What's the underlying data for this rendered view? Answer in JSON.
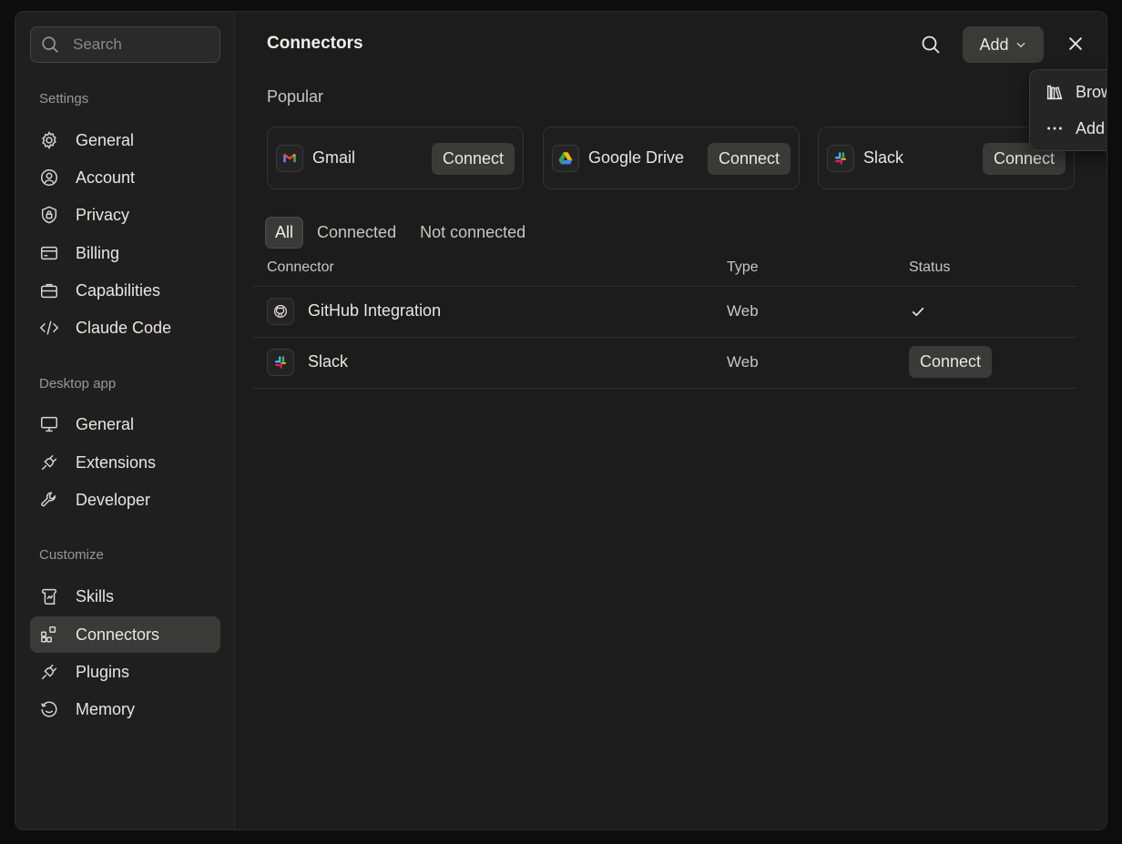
{
  "sidebar": {
    "search_placeholder": "Search",
    "sections": [
      {
        "label": "Settings",
        "items": [
          "General",
          "Account",
          "Privacy",
          "Billing",
          "Capabilities",
          "Claude Code"
        ]
      },
      {
        "label": "Desktop app",
        "items": [
          "General",
          "Extensions",
          "Developer"
        ]
      },
      {
        "label": "Customize",
        "items": [
          "Skills",
          "Connectors",
          "Plugins",
          "Memory"
        ]
      }
    ],
    "active_item": "Connectors"
  },
  "header": {
    "title": "Connectors",
    "add_label": "Add"
  },
  "popular": {
    "label": "Popular",
    "cards": [
      {
        "name": "Gmail",
        "action": "Connect"
      },
      {
        "name": "Google Drive",
        "action": "Connect"
      },
      {
        "name": "Slack",
        "action": "Connect"
      }
    ]
  },
  "tabs": {
    "items": [
      "All",
      "Connected",
      "Not connected"
    ],
    "active": "All"
  },
  "table": {
    "columns": [
      "Connector",
      "Type",
      "Status"
    ],
    "rows": [
      {
        "name": "GitHub Integration",
        "type": "Web",
        "status": "connected",
        "status_icon": "check-icon"
      },
      {
        "name": "Slack",
        "type": "Web",
        "status": "Connect"
      }
    ]
  },
  "add_menu": {
    "items": [
      {
        "label": "Browse connectors",
        "icon": "library-icon"
      },
      {
        "label": "Add custom connector",
        "icon": "more-horizontal-icon"
      }
    ]
  }
}
